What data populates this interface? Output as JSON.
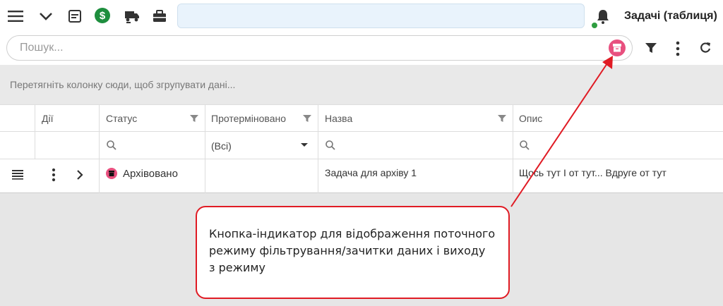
{
  "header": {
    "title": "Задачі (таблиця)"
  },
  "search": {
    "placeholder": "Пошук..."
  },
  "group_panel": {
    "hint": "Перетягніть колонку сюди, щоб згрупувати дані..."
  },
  "grid": {
    "columns": [
      "Дії",
      "Статус",
      "Протерміновано",
      "Назва",
      "Опис"
    ],
    "filter_select_value": "(Всі)",
    "rows": [
      {
        "status": "Архівовано",
        "name": "Задача для архіву 1",
        "description": "Щось тут І от тут... Вдруге от тут"
      }
    ]
  },
  "callout": {
    "lines": [
      "Кнопка-індикатор для відображення поточного",
      "режиму фільтрування/зачитки даних і виходу",
      "з режиму"
    ]
  },
  "colors": {
    "accent_pink": "#e8507f",
    "money_green": "#1e8e3e",
    "annotation_red": "#e01b24",
    "notification_dot": "#2e9d3f"
  },
  "icons": [
    "menu-icon",
    "chevron-down-icon",
    "calendar-icon",
    "dollar-icon",
    "truck-icon",
    "briefcase-icon",
    "bell-icon",
    "archive-icon",
    "filter-icon",
    "more-vertical-icon",
    "refresh-icon",
    "search-icon",
    "caret-down-icon",
    "row-menu-icon",
    "chevron-right-icon"
  ]
}
